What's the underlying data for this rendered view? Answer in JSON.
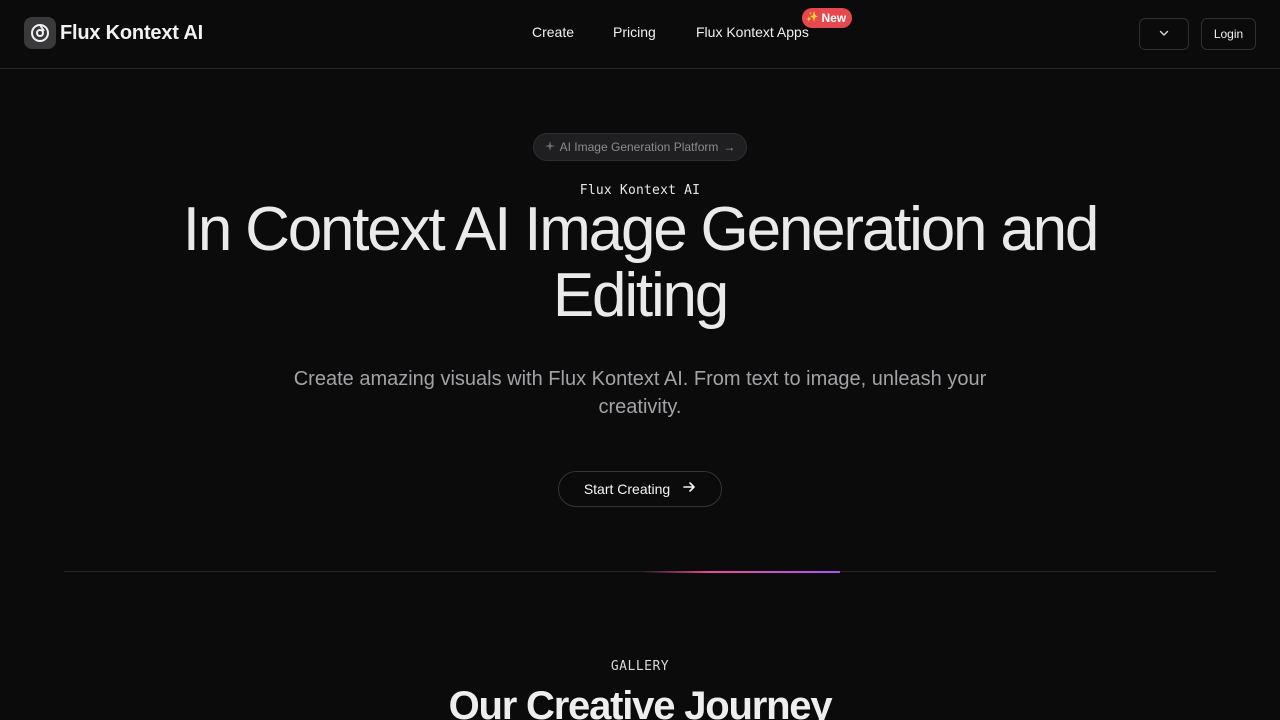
{
  "header": {
    "brand": "Flux Kontext AI",
    "logo_icon": "aperture-icon",
    "nav": {
      "create": "Create",
      "pricing": "Pricing",
      "apps": "Flux Kontext Apps",
      "apps_badge": "New",
      "apps_badge_icon": "sparkle-icon"
    },
    "language_icon": "chevron-down-icon",
    "login_label": "Login"
  },
  "hero": {
    "pill_label": "AI Image Generation Platform",
    "pill_icon": "sparkle-icon",
    "pill_arrow": "arrow-right-icon",
    "eyebrow": "Flux Kontext AI",
    "title": "In Context AI Image Generation and Editing",
    "subtitle": "Create amazing visuals with Flux Kontext AI. From text to image, unleash your creativity.",
    "cta_label": "Start Creating",
    "cta_arrow": "arrow-right-icon"
  },
  "gallery": {
    "label": "GALLERY",
    "title": "Our Creative Journey"
  },
  "colors": {
    "background": "#0b0b0c",
    "badge": "#e5484d",
    "accent_pink": "#ec4899",
    "accent_purple": "#a855f7"
  }
}
